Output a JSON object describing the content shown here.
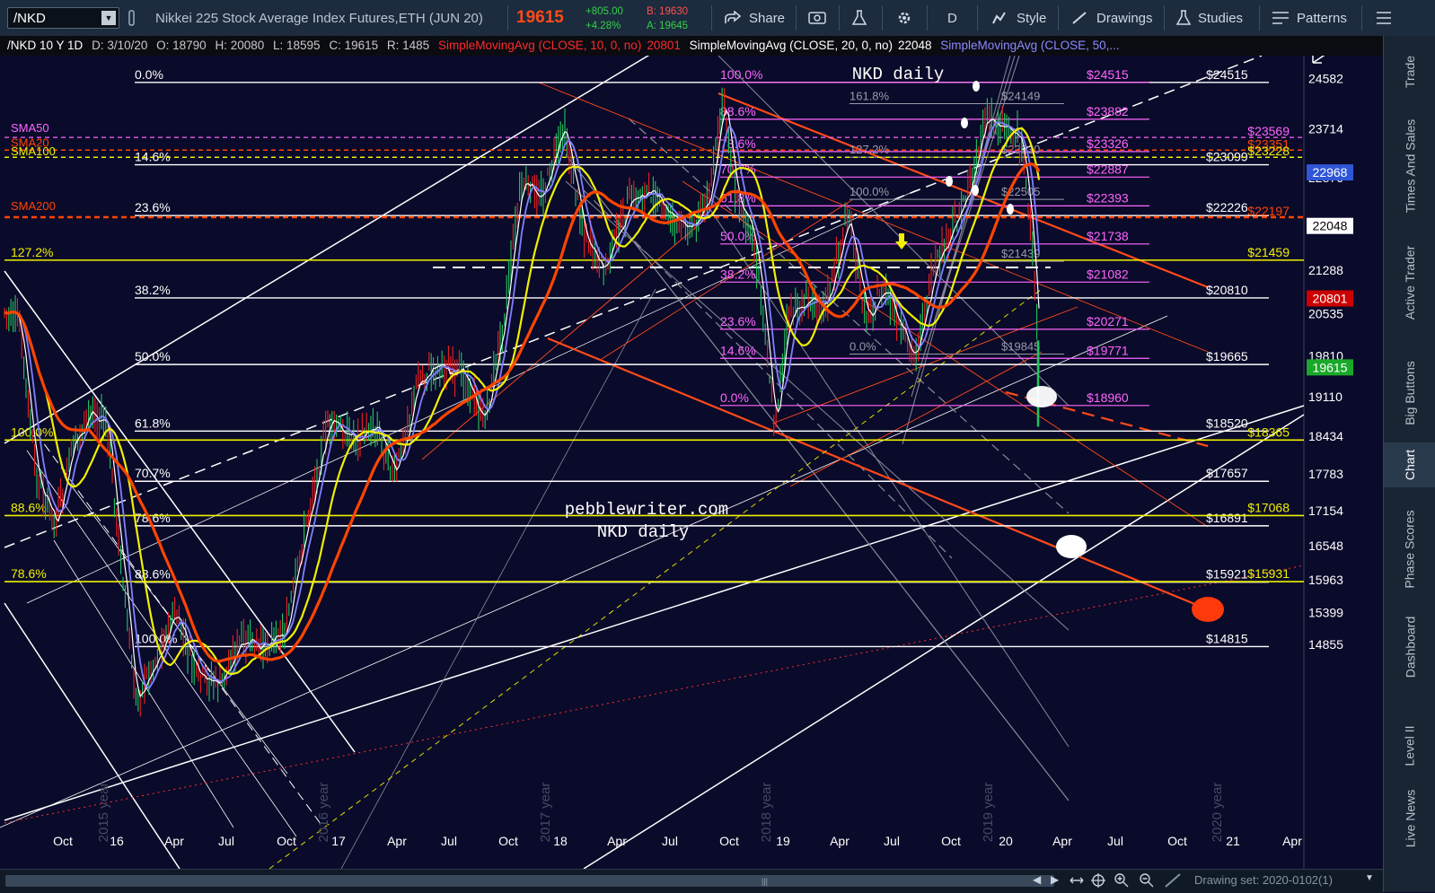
{
  "toolbar": {
    "symbol": "/NKD",
    "description": "Nikkei 225 Stock Average Index Futures,ETH (JUN 20)",
    "last": "19615",
    "change": "+805.00",
    "change_pct": "+4.28%",
    "bid": "B: 19630",
    "ask": "A: 19645",
    "share": "Share",
    "period": "D",
    "style": "Style",
    "drawings": "Drawings",
    "studies": "Studies",
    "patterns": "Patterns"
  },
  "header": {
    "title": "/NKD 10 Y 1D",
    "date": "D: 3/10/20",
    "open": "O: 18790",
    "high": "H: 20080",
    "low": "L: 18595",
    "close": "C: 19615",
    "range": "R: 1485",
    "sma10": "SimpleMovingAvg (CLOSE, 10, 0, no)",
    "sma10_val": "20801",
    "sma20": "SimpleMovingAvg (CLOSE, 20, 0, no)",
    "sma20_val": "22048",
    "sma50": "SimpleMovingAvg (CLOSE, 50,..."
  },
  "right_tabs": [
    "Trade",
    "Times And Sales",
    "Active Trader",
    "Big Buttons",
    "Chart",
    "Phase Scores",
    "Dashboard",
    "Level II",
    "Live News"
  ],
  "active_tab": "Chart",
  "bottom": {
    "drawing_set": "Drawing set: 2020-0102(1)"
  },
  "colors": {
    "bg": "#0a0a2a",
    "up": "#22c55e",
    "down": "#ef2020",
    "sma10": "#ffffff",
    "sma20": "#8080ff",
    "sma50": "#f0f000",
    "sma200": "#ff4500",
    "magenta": "#ff66ff",
    "yellow": "#f0f000"
  },
  "chart_data": {
    "type": "line",
    "x_ticks": [
      "Oct",
      "16",
      "Apr",
      "Jul",
      "Oct",
      "17",
      "Apr",
      "Jul",
      "Oct",
      "18",
      "Apr",
      "Jul",
      "Oct",
      "19",
      "Apr",
      "Jul",
      "Oct",
      "20",
      "Apr",
      "Jul",
      "Oct",
      "21",
      "Apr"
    ],
    "y_ticks": [
      24582,
      23714,
      22876,
      21288,
      20535,
      19810,
      19110,
      18434,
      17783,
      17154,
      16548,
      15963,
      15399,
      14855
    ],
    "ylim": [
      14600,
      25100
    ],
    "price_tags": [
      {
        "value": 22968,
        "label": "22968",
        "color": "#2f56d6"
      },
      {
        "value": 22048,
        "label": "22048",
        "color": "#ffffff"
      },
      {
        "value": 20801,
        "label": "20801",
        "color": "#cc0000"
      },
      {
        "value": 19615,
        "label": "19615",
        "color": "#1aa82a"
      }
    ],
    "watermarks": [
      {
        "text": "pebblewriter.com"
      },
      {
        "text": "NKD daily"
      },
      {
        "text": "NKD daily"
      }
    ],
    "year_marks": [
      "2015 year",
      "2016 year",
      "2017 year",
      "2018 year",
      "2019 year",
      "2020 year"
    ],
    "sma_tags": [
      {
        "label": "SMA50",
        "color": "#ff66ff"
      },
      {
        "label": "SMA20",
        "color": "#ff4500"
      },
      {
        "label": "SMA100",
        "color": "#f0f000"
      },
      {
        "label": "SMA200",
        "color": "#ff4500"
      }
    ],
    "white_levels": [
      {
        "value": 24515,
        "left": "0.0%",
        "right": "$24515"
      },
      {
        "value": 23099,
        "left": "14.6%",
        "right": "$23099"
      },
      {
        "value": 22226,
        "left": "23.6%",
        "right": "$22226"
      },
      {
        "value": 20810,
        "left": "38.2%",
        "right": "$20810"
      },
      {
        "value": 19665,
        "left": "50.0%",
        "right": "$19665"
      },
      {
        "value": 18520,
        "left": "61.8%",
        "right": "$18520"
      },
      {
        "value": 17657,
        "left": "70.7%",
        "right": "$17657"
      },
      {
        "value": 16891,
        "left": "78.6%",
        "right": "$16891"
      },
      {
        "value": 15921,
        "left": "88.6%",
        "right": "$15921"
      },
      {
        "value": 14815,
        "left": "100.0%",
        "right": "$14815"
      }
    ],
    "yellow_levels": [
      {
        "value": 21459,
        "left": "127.2%",
        "right": "$21459"
      },
      {
        "value": 18365,
        "left": "100.0%",
        "right": "$18365"
      },
      {
        "value": 17068,
        "left": "88.6%",
        "right": "$17068"
      },
      {
        "value": 15931,
        "left": "78.6%",
        "right": "$15931"
      }
    ],
    "magenta_levels": [
      {
        "value": 24515,
        "left": "100.0%",
        "right": "$24515"
      },
      {
        "value": 23882,
        "left": "88.6%",
        "right": "$23882"
      },
      {
        "value": 23326,
        "left": "78.6%",
        "right": "$23326"
      },
      {
        "value": 22887,
        "left": "70.7%",
        "right": "$22887"
      },
      {
        "value": 22393,
        "left": "61.8%",
        "right": "$22393"
      },
      {
        "value": 21738,
        "left": "50.0%",
        "right": "$21738"
      },
      {
        "value": 21082,
        "left": "38.2%",
        "right": "$21082"
      },
      {
        "value": 20271,
        "left": "23.6%",
        "right": "$20271"
      },
      {
        "value": 19771,
        "left": "14.6%",
        "right": "$19771"
      },
      {
        "value": 18960,
        "left": "0.0%",
        "right": "$18960"
      }
    ],
    "gray_levels": [
      {
        "value": 24149,
        "left": "161.8%",
        "right": "$24149"
      },
      {
        "value": 23230,
        "left": "127.2%",
        "right": "$23230"
      },
      {
        "value": 22505,
        "left": "100.0%",
        "right": "$22505"
      },
      {
        "value": 21439,
        "left": "",
        "right": "$21439"
      },
      {
        "value": 19845,
        "left": "0.0%",
        "right": "$19845"
      }
    ],
    "sma_right_labels": [
      {
        "value": 23569,
        "label": "$23569",
        "color": "#ff66ff"
      },
      {
        "value": 23351,
        "label": "$23351",
        "color": "#ff4500"
      },
      {
        "value": 23228,
        "label": "$23228",
        "color": "#f0f000"
      },
      {
        "value": 22197,
        "label": "$22197",
        "color": "#ff4500"
      }
    ]
  }
}
